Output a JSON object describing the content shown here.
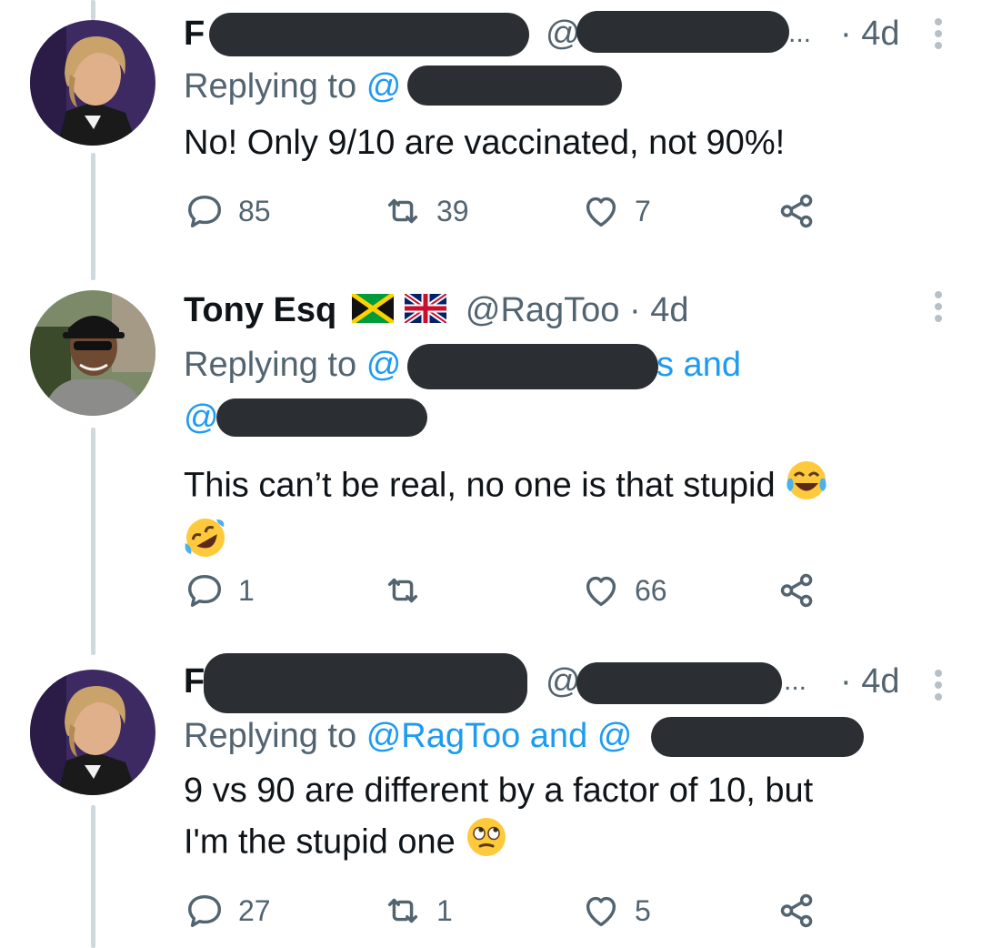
{
  "tweets": [
    {
      "name_visible": "F",
      "handle_prefix": "@",
      "ellipsis": "...",
      "time": "· 4d",
      "replying_label": "Replying to",
      "reply_handle_prefix": "@",
      "text": "No! Only 9/10 are vaccinated, not 90%!",
      "replies": "85",
      "retweets": "39",
      "likes": "7"
    },
    {
      "name": "Tony Esq",
      "handle": "@RagToo",
      "time": "· 4d",
      "replying_label": "Replying to",
      "reply_handle_prefix": "@",
      "reply_suffix": "s and",
      "reply_second_prefix": "@",
      "text": "This can’t be real, no one is that stupid",
      "replies": "1",
      "retweets": "",
      "likes": "66",
      "flag_icons": [
        "jamaica-flag-icon",
        "uk-flag-icon"
      ],
      "emoji_icons": [
        "face-with-tears-of-joy-icon",
        "rolling-on-floor-laughing-icon"
      ]
    },
    {
      "name_visible": "F",
      "handle_prefix": "@",
      "ellipsis": "...",
      "time": "· 4d",
      "replying_label": "Replying to",
      "reply_handle": "@RagToo and @",
      "text_line1": "9 vs 90 are different by a factor of 10, but",
      "text_line2": "I'm the stupid one",
      "replies": "27",
      "retweets": "1",
      "likes": "5",
      "emoji_icons": [
        "face-with-rolling-eyes-icon"
      ]
    }
  ],
  "colors": {
    "link": "#1d9bf0",
    "secondary": "#536471",
    "redaction": "#2b2f33",
    "thread_line": "#cfd9de"
  }
}
